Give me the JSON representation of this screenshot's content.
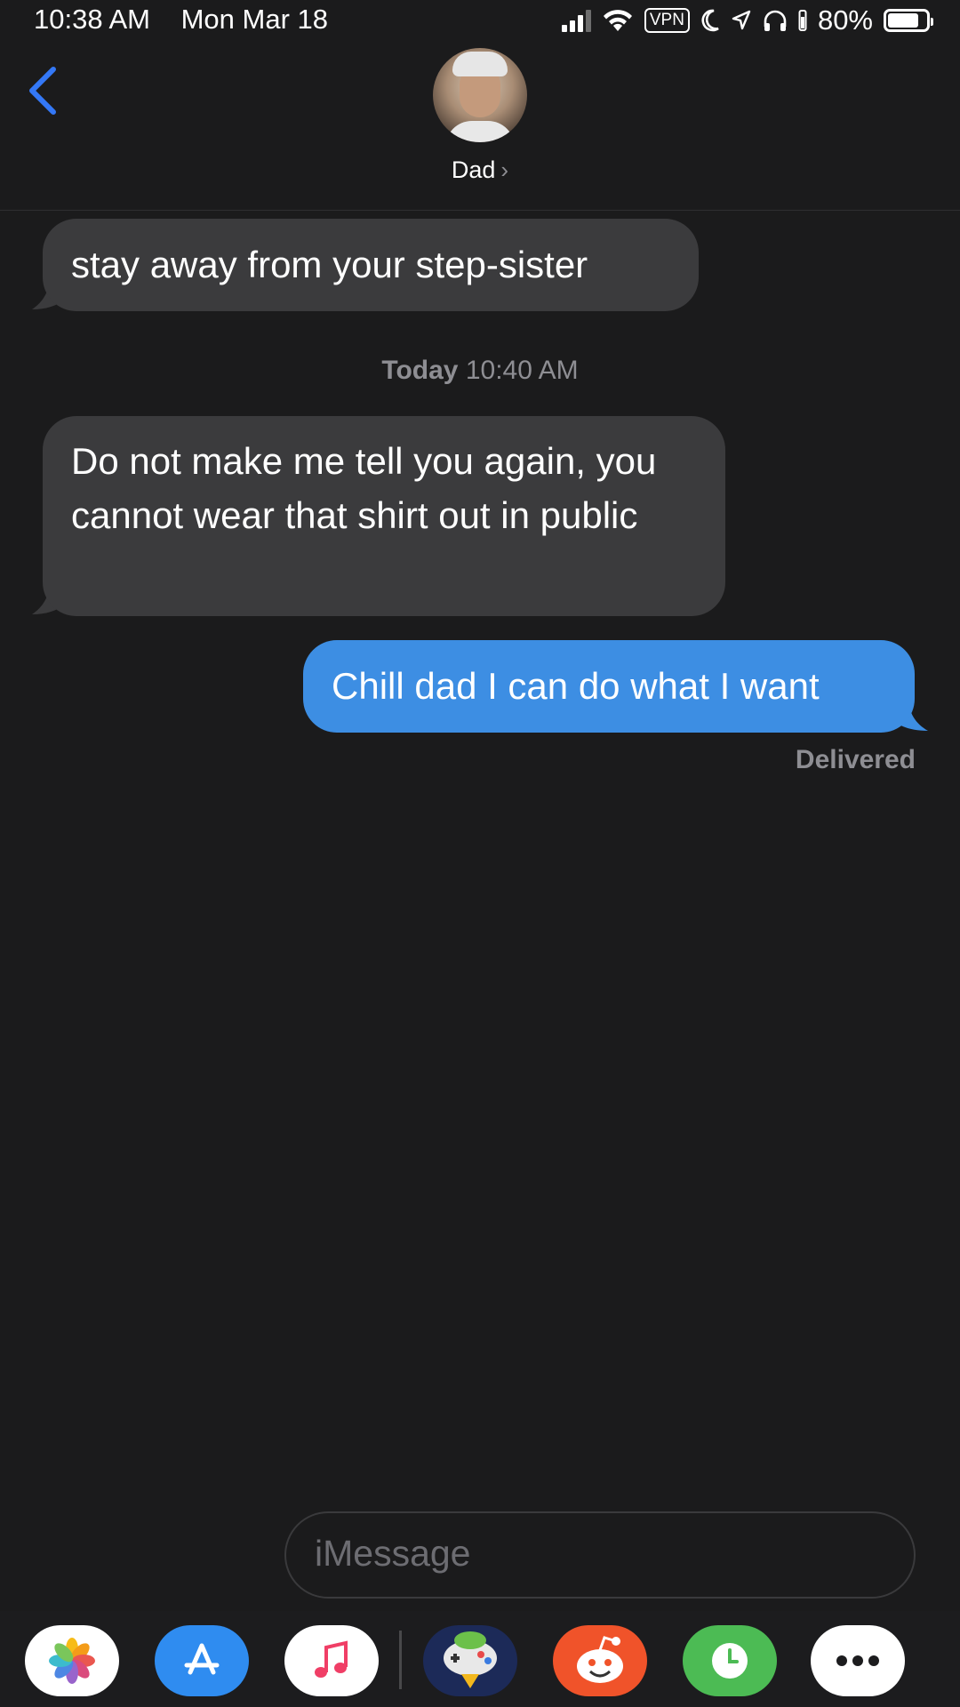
{
  "status_bar": {
    "time": "10:38 AM",
    "date": "Mon Mar 18",
    "vpn": "VPN",
    "battery": "80%",
    "battery_level": 0.8
  },
  "header": {
    "contact_name": "Dad",
    "chevron": "›",
    "back_icon": "chevron-left-icon",
    "avatar": "avatar"
  },
  "messages": [
    {
      "direction": "incoming",
      "text": "stay away from your step-sister"
    },
    {
      "direction": "incoming",
      "text": "Do not make me tell you again, you cannot wear that shirt out in public"
    },
    {
      "direction": "outgoing",
      "text": "Chill dad I can do what I want"
    }
  ],
  "timestamp": {
    "day": "Today",
    "time": "10:40 AM"
  },
  "delivery_status": "Delivered",
  "input": {
    "placeholder": "iMessage"
  },
  "app_drawer": [
    {
      "name": "photos-app-icon"
    },
    {
      "name": "app-store-icon"
    },
    {
      "name": "music-icon"
    },
    {
      "name": "game-app-icon"
    },
    {
      "name": "reddit-icon"
    },
    {
      "name": "clock-app-icon"
    },
    {
      "name": "more-apps-icon"
    }
  ],
  "colors": {
    "background": "#1b1b1c",
    "incoming_bubble": "#3b3b3d",
    "outgoing_bubble": "#3d8ee3",
    "accent_blue": "#3478f6",
    "secondary_text": "#8e8e93"
  }
}
